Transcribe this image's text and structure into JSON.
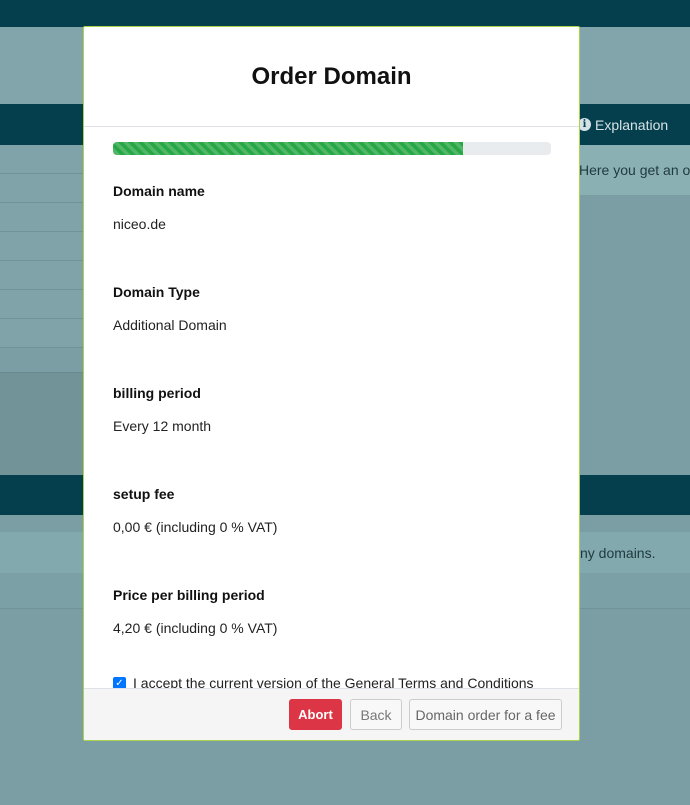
{
  "background": {
    "explanation_label": "Explanation",
    "info_icon": "i",
    "overview_text": "Here you get an ov",
    "notice_text": "ny domains."
  },
  "modal": {
    "title": "Order Domain",
    "progress_fraction": 0.8,
    "fields": [
      {
        "label": "Domain name",
        "value": "niceo.de"
      },
      {
        "label": "Domain Type",
        "value": "Additional Domain"
      },
      {
        "label": "billing period",
        "value": "Every 12 month"
      },
      {
        "label": "setup fee",
        "value": "0,00 € (including 0 % VAT)"
      },
      {
        "label": "Price per billing period",
        "value": "4,20 € (including 0 % VAT)"
      }
    ],
    "terms_checked": true,
    "terms_text": "I accept the current version of the General Terms and Conditions (T&C's) of netcup GmbH. See Terms and conditions I have also taken note of the cancellation policy. See cancellation policy",
    "footer": {
      "abort_label": "Abort",
      "back_label": "Back",
      "order_label": "Domain order for a fee"
    }
  },
  "colors": {
    "primary_dark": "#053f4e",
    "progress": "#28a745",
    "danger": "#dc3545",
    "checkbox": "#0075ff"
  }
}
